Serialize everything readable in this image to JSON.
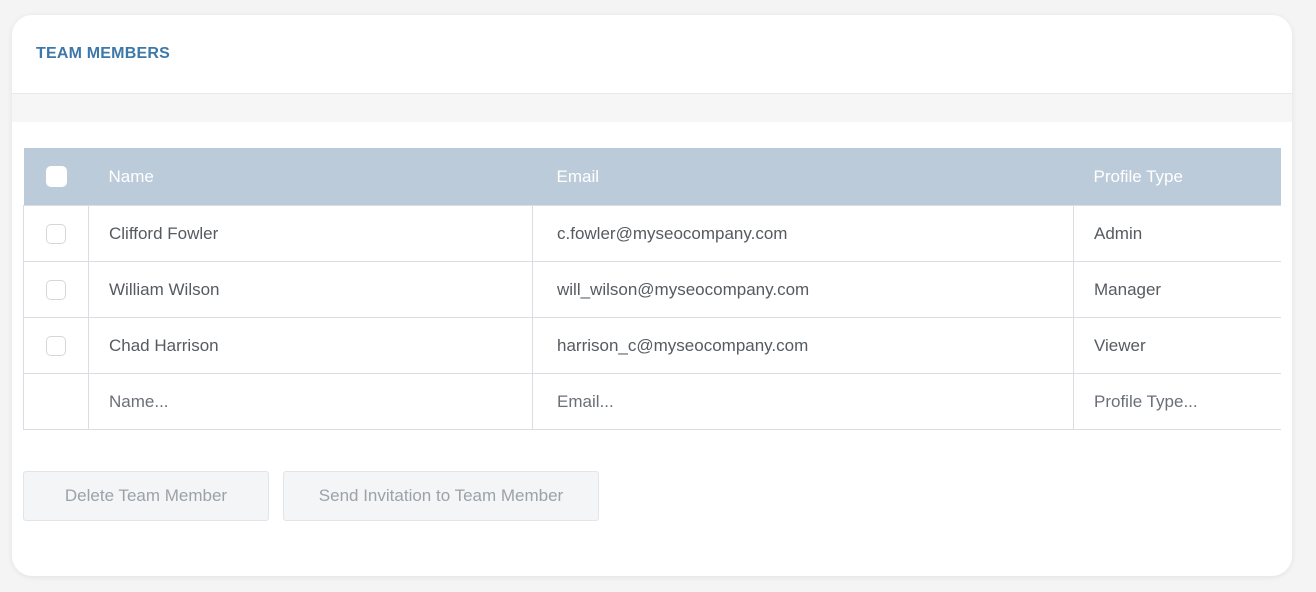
{
  "panel": {
    "title": "TEAM MEMBERS"
  },
  "table": {
    "columns": {
      "name": "Name",
      "email": "Email",
      "profile_type": "Profile Type"
    },
    "rows": [
      {
        "name": "Clifford Fowler",
        "email": "c.fowler@myseocompany.com",
        "profile_type": "Admin"
      },
      {
        "name": "William Wilson",
        "email": "will_wilson@myseocompany.com",
        "profile_type": "Manager"
      },
      {
        "name": "Chad Harrison",
        "email": "harrison_c@myseocompany.com",
        "profile_type": "Viewer"
      }
    ],
    "new_row": {
      "name_placeholder": "Name...",
      "email_placeholder": "Email...",
      "profile_type_placeholder": "Profile Type..."
    }
  },
  "actions": {
    "delete_label": "Delete Team Member",
    "invite_label": "Send Invitation to Team Member"
  },
  "colors": {
    "title": "#3d78a8",
    "table_header": "#bccbda",
    "button_bg": "#f3f5f7"
  }
}
